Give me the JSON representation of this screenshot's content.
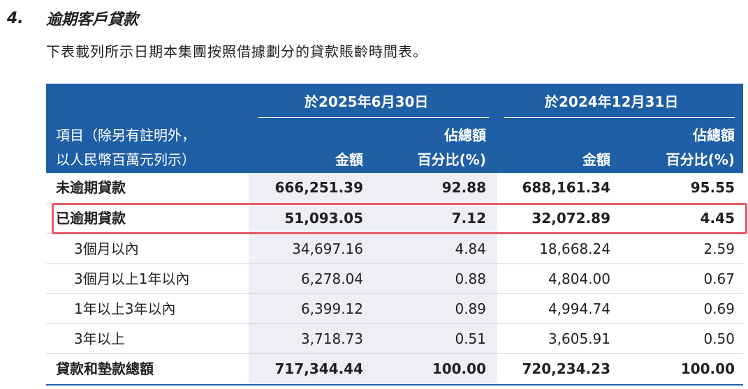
{
  "section": {
    "number": "4.",
    "title": "逾期客戶貸款"
  },
  "intro": "下表載列所示日期本集團按照借據劃分的貸款賬齡時間表。",
  "table": {
    "header": {
      "item_line1": "項目（除另有註明外，",
      "item_line2": "以人民幣百萬元列示）",
      "period1": "於2025年6月30日",
      "period2": "於2024年12月31日",
      "amount": "金額",
      "pct_line1": "佔總額",
      "pct_line2": "百分比(%)"
    },
    "rows": [
      {
        "label": "未逾期貸款",
        "a1": "666,251.39",
        "p1": "92.88",
        "a2": "688,161.34",
        "p2": "95.55"
      },
      {
        "label": "已逾期貸款",
        "a1": "51,093.05",
        "p1": "7.12",
        "a2": "32,072.89",
        "p2": "4.45"
      },
      {
        "label": "3個月以內",
        "a1": "34,697.16",
        "p1": "4.84",
        "a2": "18,668.24",
        "p2": "2.59"
      },
      {
        "label": "3個月以上1年以內",
        "a1": "6,278.04",
        "p1": "0.88",
        "a2": "4,804.00",
        "p2": "0.67"
      },
      {
        "label": "1年以上3年以內",
        "a1": "6,399.12",
        "p1": "0.89",
        "a2": "4,994.74",
        "p2": "0.69"
      },
      {
        "label": "3年以上",
        "a1": "3,718.73",
        "p1": "0.51",
        "a2": "3,605.91",
        "p2": "0.50"
      },
      {
        "label": "貸款和墊款總額",
        "a1": "717,344.44",
        "p1": "100.00",
        "a2": "720,234.23",
        "p2": "100.00"
      }
    ]
  },
  "colors": {
    "header_bg": "#1e5fa6",
    "shade": "#eeeef5",
    "highlight_border": "#e85b64"
  }
}
